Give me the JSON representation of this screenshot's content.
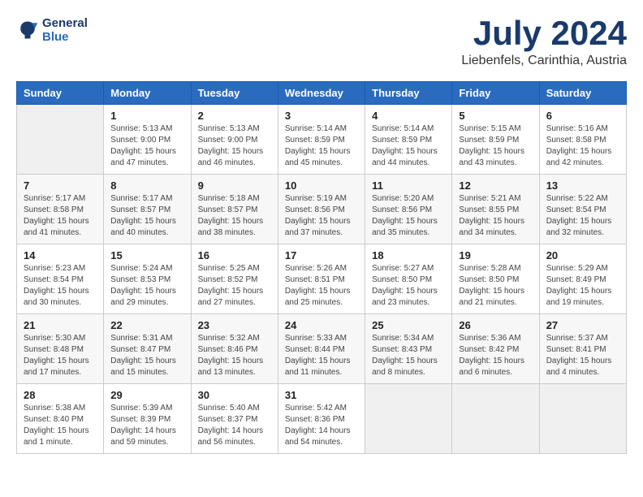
{
  "header": {
    "logo_line1": "General",
    "logo_line2": "Blue",
    "month_year": "July 2024",
    "location": "Liebenfels, Carinthia, Austria"
  },
  "weekdays": [
    "Sunday",
    "Monday",
    "Tuesday",
    "Wednesday",
    "Thursday",
    "Friday",
    "Saturday"
  ],
  "weeks": [
    [
      {
        "day": "",
        "info": ""
      },
      {
        "day": "1",
        "info": "Sunrise: 5:13 AM\nSunset: 9:00 PM\nDaylight: 15 hours\nand 47 minutes."
      },
      {
        "day": "2",
        "info": "Sunrise: 5:13 AM\nSunset: 9:00 PM\nDaylight: 15 hours\nand 46 minutes."
      },
      {
        "day": "3",
        "info": "Sunrise: 5:14 AM\nSunset: 8:59 PM\nDaylight: 15 hours\nand 45 minutes."
      },
      {
        "day": "4",
        "info": "Sunrise: 5:14 AM\nSunset: 8:59 PM\nDaylight: 15 hours\nand 44 minutes."
      },
      {
        "day": "5",
        "info": "Sunrise: 5:15 AM\nSunset: 8:59 PM\nDaylight: 15 hours\nand 43 minutes."
      },
      {
        "day": "6",
        "info": "Sunrise: 5:16 AM\nSunset: 8:58 PM\nDaylight: 15 hours\nand 42 minutes."
      }
    ],
    [
      {
        "day": "7",
        "info": "Sunrise: 5:17 AM\nSunset: 8:58 PM\nDaylight: 15 hours\nand 41 minutes."
      },
      {
        "day": "8",
        "info": "Sunrise: 5:17 AM\nSunset: 8:57 PM\nDaylight: 15 hours\nand 40 minutes."
      },
      {
        "day": "9",
        "info": "Sunrise: 5:18 AM\nSunset: 8:57 PM\nDaylight: 15 hours\nand 38 minutes."
      },
      {
        "day": "10",
        "info": "Sunrise: 5:19 AM\nSunset: 8:56 PM\nDaylight: 15 hours\nand 37 minutes."
      },
      {
        "day": "11",
        "info": "Sunrise: 5:20 AM\nSunset: 8:56 PM\nDaylight: 15 hours\nand 35 minutes."
      },
      {
        "day": "12",
        "info": "Sunrise: 5:21 AM\nSunset: 8:55 PM\nDaylight: 15 hours\nand 34 minutes."
      },
      {
        "day": "13",
        "info": "Sunrise: 5:22 AM\nSunset: 8:54 PM\nDaylight: 15 hours\nand 32 minutes."
      }
    ],
    [
      {
        "day": "14",
        "info": "Sunrise: 5:23 AM\nSunset: 8:54 PM\nDaylight: 15 hours\nand 30 minutes."
      },
      {
        "day": "15",
        "info": "Sunrise: 5:24 AM\nSunset: 8:53 PM\nDaylight: 15 hours\nand 29 minutes."
      },
      {
        "day": "16",
        "info": "Sunrise: 5:25 AM\nSunset: 8:52 PM\nDaylight: 15 hours\nand 27 minutes."
      },
      {
        "day": "17",
        "info": "Sunrise: 5:26 AM\nSunset: 8:51 PM\nDaylight: 15 hours\nand 25 minutes."
      },
      {
        "day": "18",
        "info": "Sunrise: 5:27 AM\nSunset: 8:50 PM\nDaylight: 15 hours\nand 23 minutes."
      },
      {
        "day": "19",
        "info": "Sunrise: 5:28 AM\nSunset: 8:50 PM\nDaylight: 15 hours\nand 21 minutes."
      },
      {
        "day": "20",
        "info": "Sunrise: 5:29 AM\nSunset: 8:49 PM\nDaylight: 15 hours\nand 19 minutes."
      }
    ],
    [
      {
        "day": "21",
        "info": "Sunrise: 5:30 AM\nSunset: 8:48 PM\nDaylight: 15 hours\nand 17 minutes."
      },
      {
        "day": "22",
        "info": "Sunrise: 5:31 AM\nSunset: 8:47 PM\nDaylight: 15 hours\nand 15 minutes."
      },
      {
        "day": "23",
        "info": "Sunrise: 5:32 AM\nSunset: 8:46 PM\nDaylight: 15 hours\nand 13 minutes."
      },
      {
        "day": "24",
        "info": "Sunrise: 5:33 AM\nSunset: 8:44 PM\nDaylight: 15 hours\nand 11 minutes."
      },
      {
        "day": "25",
        "info": "Sunrise: 5:34 AM\nSunset: 8:43 PM\nDaylight: 15 hours\nand 8 minutes."
      },
      {
        "day": "26",
        "info": "Sunrise: 5:36 AM\nSunset: 8:42 PM\nDaylight: 15 hours\nand 6 minutes."
      },
      {
        "day": "27",
        "info": "Sunrise: 5:37 AM\nSunset: 8:41 PM\nDaylight: 15 hours\nand 4 minutes."
      }
    ],
    [
      {
        "day": "28",
        "info": "Sunrise: 5:38 AM\nSunset: 8:40 PM\nDaylight: 15 hours\nand 1 minute."
      },
      {
        "day": "29",
        "info": "Sunrise: 5:39 AM\nSunset: 8:39 PM\nDaylight: 14 hours\nand 59 minutes."
      },
      {
        "day": "30",
        "info": "Sunrise: 5:40 AM\nSunset: 8:37 PM\nDaylight: 14 hours\nand 56 minutes."
      },
      {
        "day": "31",
        "info": "Sunrise: 5:42 AM\nSunset: 8:36 PM\nDaylight: 14 hours\nand 54 minutes."
      },
      {
        "day": "",
        "info": ""
      },
      {
        "day": "",
        "info": ""
      },
      {
        "day": "",
        "info": ""
      }
    ]
  ]
}
